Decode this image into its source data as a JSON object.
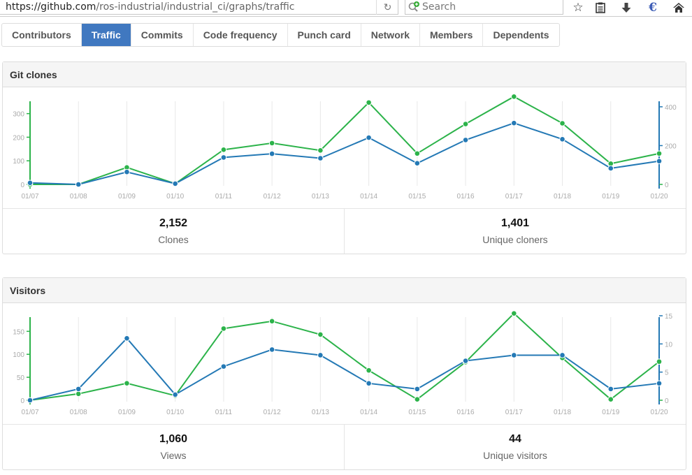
{
  "browser": {
    "url_host": "https://github.com",
    "url_path": "/ros-industrial/industrial_ci/graphs/traffic",
    "search_placeholder": "Search",
    "icons": [
      "reload-icon",
      "search-icon",
      "bookmark-star-icon",
      "reading-list-icon",
      "download-icon",
      "extension-g-icon",
      "home-icon"
    ]
  },
  "tabs": [
    {
      "label": "Contributors",
      "active": false
    },
    {
      "label": "Traffic",
      "active": true
    },
    {
      "label": "Commits",
      "active": false
    },
    {
      "label": "Code frequency",
      "active": false
    },
    {
      "label": "Punch card",
      "active": false
    },
    {
      "label": "Network",
      "active": false
    },
    {
      "label": "Members",
      "active": false
    },
    {
      "label": "Dependents",
      "active": false
    }
  ],
  "colors": {
    "accent": "#4078c0",
    "green": "#2cb34a",
    "blue": "#2479b5"
  },
  "clones": {
    "title": "Git clones",
    "stats": [
      {
        "value": "2,152",
        "label": "Clones"
      },
      {
        "value": "1,401",
        "label": "Unique cloners"
      }
    ]
  },
  "visitors": {
    "title": "Visitors",
    "stats": [
      {
        "value": "1,060",
        "label": "Views"
      },
      {
        "value": "44",
        "label": "Unique visitors"
      }
    ]
  },
  "chart_data": [
    {
      "type": "line",
      "title": "Git clones",
      "x": [
        "01/07",
        "01/08",
        "01/09",
        "01/10",
        "01/11",
        "01/12",
        "01/13",
        "01/14",
        "01/15",
        "01/16",
        "01/17",
        "01/18",
        "01/19",
        "01/20"
      ],
      "series": [
        {
          "name": "Clones",
          "color": "#2cb34a",
          "axis": "left",
          "values": [
            0,
            0,
            72,
            3,
            147,
            175,
            144,
            347,
            131,
            256,
            372,
            259,
            88,
            131
          ]
        },
        {
          "name": "Unique cloners",
          "color": "#2479b5",
          "axis": "right",
          "values": [
            8,
            0,
            64,
            4,
            139,
            158,
            135,
            241,
            109,
            229,
            316,
            233,
            83,
            120
          ]
        }
      ],
      "left_axis": {
        "ticks": [
          0,
          100,
          200,
          300
        ],
        "ylim": [
          0,
          370
        ]
      },
      "right_axis": {
        "ticks": [
          0,
          200,
          400
        ],
        "ylim": [
          0,
          450
        ]
      },
      "grid": "vertical"
    },
    {
      "type": "line",
      "title": "Visitors",
      "x": [
        "01/07",
        "01/08",
        "01/09",
        "01/10",
        "01/11",
        "01/12",
        "01/13",
        "01/14",
        "01/15",
        "01/16",
        "01/17",
        "01/18",
        "01/19",
        "01/20"
      ],
      "series": [
        {
          "name": "Views",
          "color": "#2cb34a",
          "axis": "left",
          "values": [
            0,
            14,
            37,
            10,
            156,
            172,
            143,
            65,
            2,
            83,
            189,
            92,
            2,
            84
          ]
        },
        {
          "name": "Unique visitors",
          "color": "#2479b5",
          "axis": "right",
          "values": [
            0,
            2,
            11,
            1,
            6,
            9,
            8,
            3,
            2,
            7,
            8,
            8,
            2,
            3
          ]
        }
      ],
      "left_axis": {
        "ticks": [
          0,
          50,
          100,
          150
        ],
        "ylim": [
          0,
          190
        ]
      },
      "right_axis": {
        "ticks": [
          0,
          5,
          10,
          15
        ],
        "ylim": [
          0,
          15.5
        ]
      },
      "grid": "vertical"
    }
  ]
}
